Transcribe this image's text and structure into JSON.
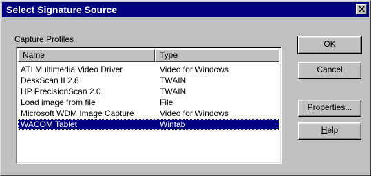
{
  "window": {
    "title": "Select Signature Source",
    "close_icon": "close-icon"
  },
  "group": {
    "label_prefix": "Capture ",
    "label_accel": "P",
    "label_suffix": "rofiles"
  },
  "list": {
    "columns": [
      "Name",
      "Type"
    ],
    "rows": [
      {
        "name": "ATI Multimedia Video Driver",
        "type": "Video for Windows",
        "selected": false
      },
      {
        "name": "DeskScan II 2.8",
        "type": "TWAIN",
        "selected": false
      },
      {
        "name": "HP PrecisionScan 2.0",
        "type": "TWAIN",
        "selected": false
      },
      {
        "name": "Load image from file",
        "type": "File",
        "selected": false
      },
      {
        "name": "Microsoft WDM Image Capture",
        "type": "Video for Windows",
        "selected": false
      },
      {
        "name": "WACOM Tablet",
        "type": "Wintab",
        "selected": true
      }
    ]
  },
  "buttons": {
    "ok": "OK",
    "cancel": "Cancel",
    "properties_accel": "P",
    "properties_rest": "roperties...",
    "help_accel": "H",
    "help_rest": "elp"
  },
  "colors": {
    "titlebar": "#000080",
    "face": "#c0c0c0",
    "selection": "#000080"
  }
}
